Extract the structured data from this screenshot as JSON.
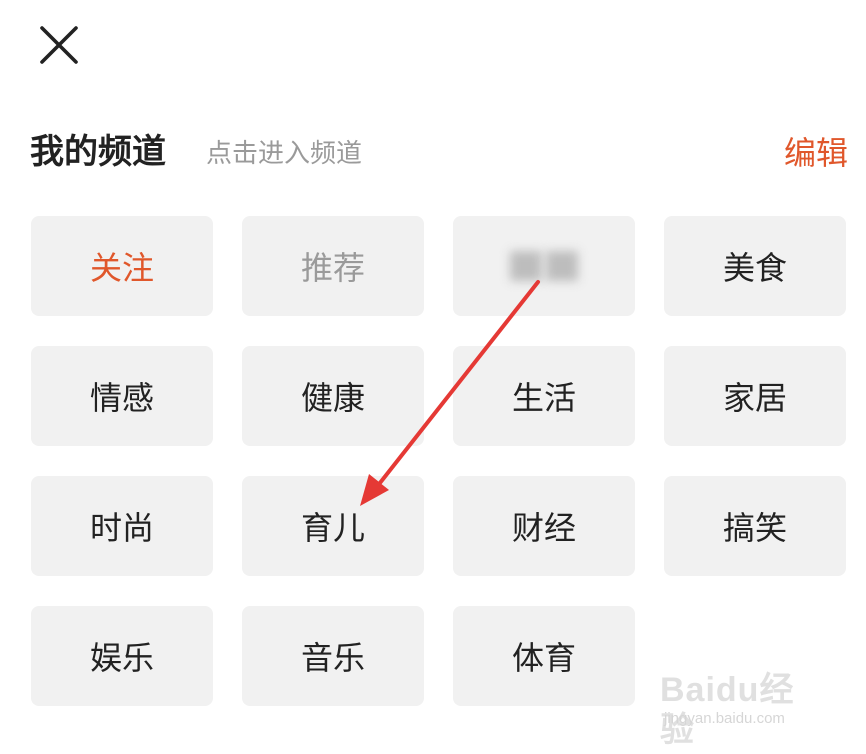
{
  "header": {
    "title": "我的频道",
    "subtitle": "点击进入频道",
    "edit_label": "编辑"
  },
  "icons": {
    "close": "close-icon"
  },
  "colors": {
    "accent": "#e0572b",
    "muted": "#9a9a9a",
    "tile_bg": "#f1f1f1",
    "arrow": "#e53935"
  },
  "channels": [
    {
      "label": "关注",
      "state": "active"
    },
    {
      "label": "推荐",
      "state": "fixed"
    },
    {
      "label": "",
      "state": "blurred"
    },
    {
      "label": "美食",
      "state": "normal"
    },
    {
      "label": "情感",
      "state": "normal"
    },
    {
      "label": "健康",
      "state": "normal"
    },
    {
      "label": "生活",
      "state": "normal"
    },
    {
      "label": "家居",
      "state": "normal"
    },
    {
      "label": "时尚",
      "state": "normal"
    },
    {
      "label": "育儿",
      "state": "normal"
    },
    {
      "label": "财经",
      "state": "normal"
    },
    {
      "label": "搞笑",
      "state": "normal"
    },
    {
      "label": "娱乐",
      "state": "normal"
    },
    {
      "label": "音乐",
      "state": "normal"
    },
    {
      "label": "体育",
      "state": "normal"
    }
  ],
  "watermark": {
    "logo": "Baidu经验",
    "url": "jingyan.baidu.com"
  }
}
